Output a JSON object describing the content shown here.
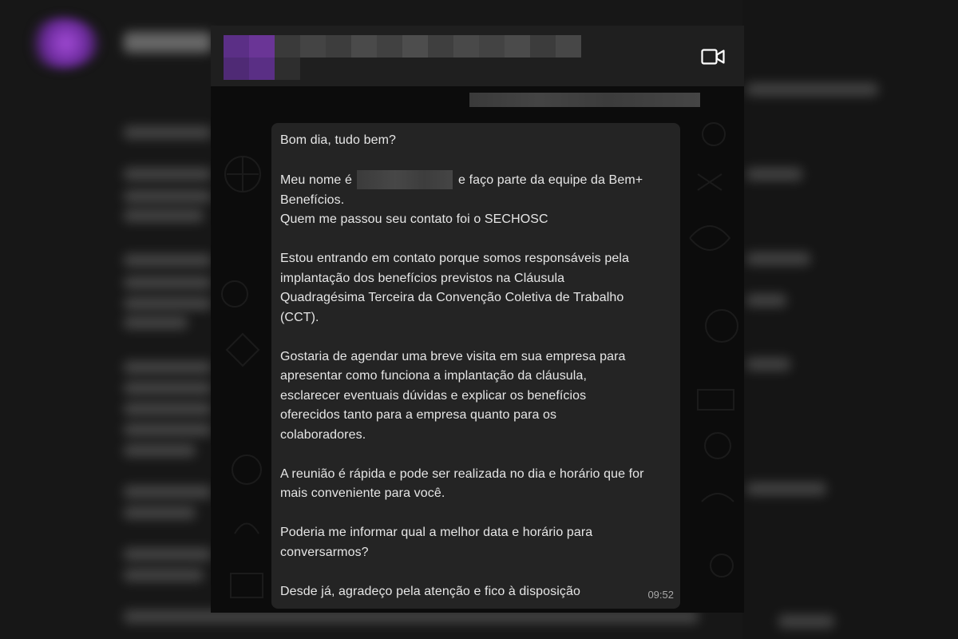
{
  "colors": {
    "bubble_bg": "#242424",
    "header_bg": "#1f1f1f",
    "accent_purple": "#7a3fb0"
  },
  "header": {
    "icons": [
      "video-call-icon"
    ]
  },
  "message": {
    "greeting": "Bom dia, tudo bem?",
    "intro_before_name": "Meu nome é",
    "intro_after_name": "e faço parte da equipe da Bem+",
    "intro_line2": "Benefícios.",
    "intro_line3": "Quem me passou seu contato foi o SECHOSC",
    "para2_l1": "Estou entrando em contato porque somos responsáveis pela",
    "para2_l2": "implantação dos benefícios previstos na Cláusula",
    "para2_l3": "Quadragésima Terceira da Convenção Coletiva de Trabalho",
    "para2_l4": "(CCT).",
    "para3_l1": "Gostaria de agendar uma breve visita em sua empresa para",
    "para3_l2": "apresentar como funciona a implantação da cláusula,",
    "para3_l3": "esclarecer eventuais dúvidas e explicar os benefícios",
    "para3_l4": "oferecidos tanto para a empresa quanto para os",
    "para3_l5": "colaboradores.",
    "para4_l1": "A reunião é rápida e pode ser realizada no dia e horário que for",
    "para4_l2": "mais conveniente para você.",
    "para5_l1": "Poderia me informar qual a melhor data e horário para",
    "para5_l2": "conversarmos?",
    "para6_l1": "Desde já, agradeço pela atenção e fico à disposição",
    "time": "09:52"
  }
}
